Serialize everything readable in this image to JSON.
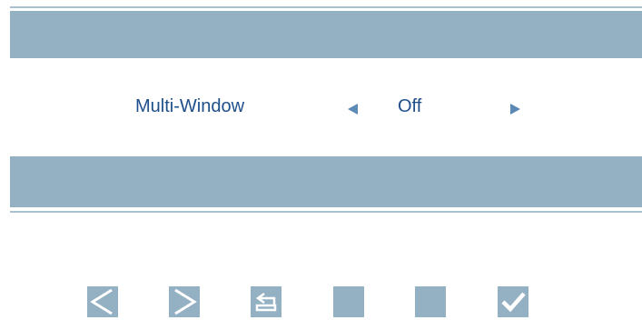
{
  "menu": {
    "setting_label": "Multi-Window",
    "setting_value": "Off",
    "left_arrow_icon": "left-triangle-icon",
    "right_arrow_icon": "right-triangle-icon"
  },
  "buttons": [
    {
      "icon": "left-chevron-icon"
    },
    {
      "icon": "right-chevron-icon"
    },
    {
      "icon": "return-arrow-icon"
    },
    {
      "icon": "blank-icon"
    },
    {
      "icon": "blank-icon"
    },
    {
      "icon": "checkmark-icon"
    }
  ],
  "colors": {
    "band": "#94b0c3",
    "text": "#1e4f8a",
    "arrow": "#5d89b5",
    "icon": "#ffffff"
  }
}
